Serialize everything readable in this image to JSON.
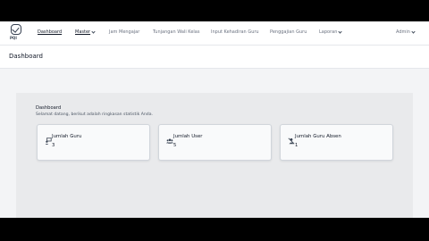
{
  "nav": {
    "logo_text": "PQI",
    "items": [
      {
        "label": "Dashboard"
      },
      {
        "label": "Master"
      },
      {
        "label": "Jam Mengajar"
      },
      {
        "label": "Tunjangan Wali Kelas"
      },
      {
        "label": "Input Kehadiran Guru"
      },
      {
        "label": "Penggajian Guru"
      },
      {
        "label": "Laporan"
      }
    ],
    "user": "Admin"
  },
  "header": {
    "title": "Dashboard"
  },
  "panel": {
    "title": "Dashboard",
    "subtitle": "Selamat datang, berikut adalah ringkasan statistik Anda."
  },
  "cards": [
    {
      "title": "Jumlah Guru",
      "value": "3",
      "icon": "teacher-icon"
    },
    {
      "title": "Jumlah User",
      "value": "5",
      "icon": "users-icon"
    },
    {
      "title": "Jumlah Guru Absen",
      "value": "1",
      "icon": "absent-icon"
    }
  ]
}
